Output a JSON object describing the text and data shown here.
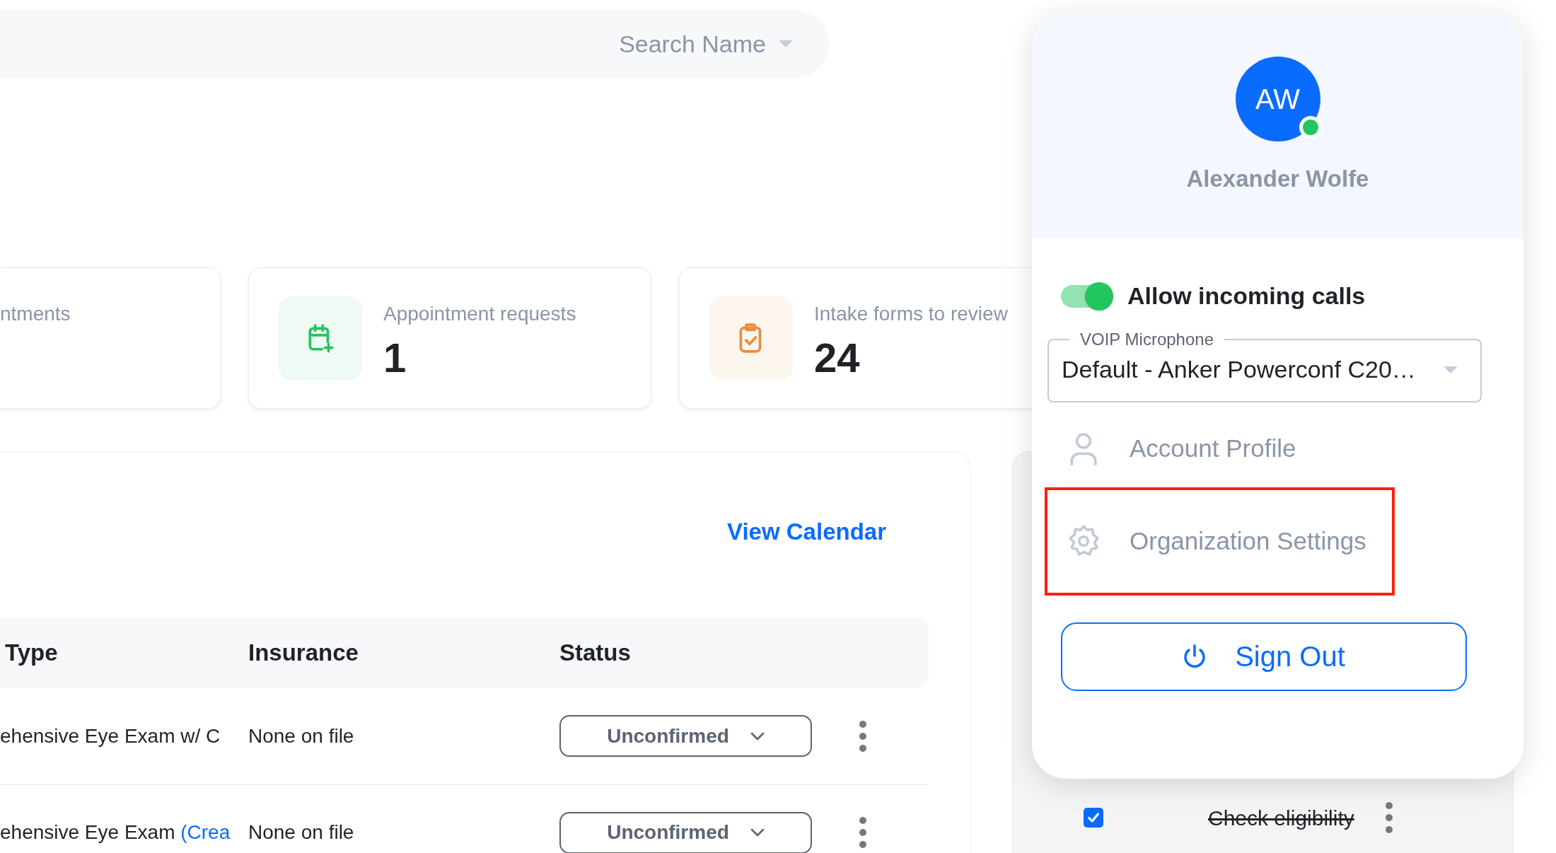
{
  "search": {
    "placeholder": "Search Name"
  },
  "stat_cards": [
    {
      "label": "ntments"
    },
    {
      "kind": "calendar",
      "label": "Appointment requests",
      "value": "1"
    },
    {
      "kind": "clipboard",
      "label": "Intake forms to review",
      "value": "24"
    }
  ],
  "schedule": {
    "link": "View Calendar",
    "columns": [
      "Type",
      "Insurance",
      "Status"
    ],
    "rows": [
      {
        "type": "ehensive Eye Exam w/ C",
        "insurance": "None on file",
        "status": "Unconfirmed"
      },
      {
        "type": "ehensive Eye Exam",
        "type_link": "(Crea",
        "insurance": "None on file",
        "status": "Unconfirmed"
      }
    ]
  },
  "tasks": [
    {
      "label": "Check eligibility",
      "done": true
    }
  ],
  "account_menu": {
    "initials": "AW",
    "name": "Alexander Wolfe",
    "online": true,
    "incoming_calls": {
      "label": "Allow incoming calls",
      "on": true
    },
    "microphone": {
      "label": "VOIP Microphone",
      "value": "Default - Anker Powerconf C20…"
    },
    "items": [
      {
        "kind": "profile",
        "label": "Account Profile",
        "highlighted": false
      },
      {
        "kind": "settings",
        "label": "Organization Settings",
        "highlighted": true
      }
    ],
    "sign_out": "Sign Out"
  }
}
